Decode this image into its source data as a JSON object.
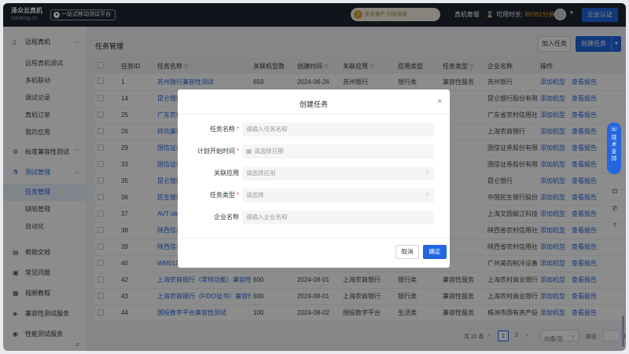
{
  "topbar": {
    "logo_line1": "泽众云真机",
    "logo_line2_prefix": "",
    "logo_line2": "ztesting.cn",
    "badge": "一站式移动测试平台",
    "notice": "实名客户 问答须奖",
    "real_device_link": "真机套餐",
    "timer_label": "可用时长:",
    "timer_value": "89361分钟",
    "cert_button": "企业认证"
  },
  "sidebar": {
    "groups": [
      {
        "label": "远程真机",
        "icon": "phone-icon",
        "items": [
          "远程真机调试",
          "多机联动",
          "调试记录",
          "真机订单",
          "我的应用"
        ]
      },
      {
        "label": "标准兼容性测试",
        "icon": "gear-icon"
      },
      {
        "label": "测试管理",
        "icon": "flask-icon",
        "items": [
          "任务管理",
          "缺陷管理",
          "自动化"
        ]
      },
      {
        "label": "帮助文档",
        "icon": "doc-icon"
      },
      {
        "label": "常见问题",
        "icon": "question-icon"
      },
      {
        "label": "视频教程",
        "icon": "video-icon"
      },
      {
        "label": "兼容性测试服务",
        "icon": "service-icon"
      },
      {
        "label": "性能测试服务",
        "icon": "perf-icon"
      }
    ]
  },
  "main": {
    "title": "任务管理",
    "join_button": "加入任务",
    "create_button": "创建任务",
    "columns": [
      "任务ID",
      "任务名称",
      "关联机型数",
      "创建时间",
      "关联应用",
      "应用类型",
      "任务类型",
      "企业名称",
      "操作"
    ],
    "rows": [
      [
        "1",
        "苏州银行兼容性测试",
        "659",
        "2024-06-26",
        "苏州银行",
        "银行类",
        "兼容性服务",
        "苏州银行"
      ],
      [
        "14",
        "昆仑银行",
        "",
        "",
        "",
        "",
        "",
        "昆仑银行股份有限"
      ],
      [
        "25",
        "广东农信",
        "",
        "",
        "",
        "",
        "",
        "广东省农村信用社"
      ],
      [
        "26",
        "绊功兼容",
        "",
        "",
        "",
        "",
        "",
        "上海农商银行"
      ],
      [
        "29",
        "国信证券",
        "",
        "",
        "",
        "",
        "",
        "国信证券股份有限"
      ],
      [
        "33",
        "国信证券",
        "",
        "",
        "",
        "",
        "",
        "国信证券股份有限"
      ],
      [
        "35",
        "昆仑银行",
        "",
        "",
        "",
        "",
        "",
        "昆仑银行"
      ],
      [
        "36",
        "民生银行",
        "",
        "",
        "",
        "",
        "",
        "中国民生银行股份"
      ],
      [
        "37",
        "AVT idea",
        "",
        "",
        "",
        "",
        "",
        "上海文圆娱江科技"
      ],
      [
        "38",
        "陕西信合",
        "",
        "",
        "",
        "",
        "",
        "陕西省农村信用社"
      ],
      [
        "39",
        "陕西信合",
        "",
        "",
        "",
        "",
        "",
        "陕西省农村信用社"
      ],
      [
        "40",
        "WM01兼容性测试",
        "",
        "",
        "",
        "",
        "",
        "广州美的制冷设备"
      ],
      [
        "42",
        "上海农商银行（常规功能）兼容性测试",
        "600",
        "2024-08-01",
        "上海农商银行",
        "银行类",
        "兼容性服务",
        "上海农村商业银行"
      ],
      [
        "43",
        "上海农商银行（FIDO证书）兼容性测试",
        "600",
        "2024-08-01",
        "上海农商银行",
        "银行类",
        "兼容性服务",
        "上海农村商业银行"
      ],
      [
        "44",
        "国投数字平台兼容性测试",
        "100",
        "2024-08-02",
        "国投数字平台",
        "生活类",
        "兼容性服务",
        "株洲市国有资产投"
      ]
    ],
    "row_actions": [
      "添加机型",
      "查看报告"
    ],
    "pager": {
      "total": "共 21 条",
      "pages": [
        "1",
        "2"
      ],
      "current": "1",
      "page_size": "20条/页",
      "goto_label": "前往",
      "goto_suffix": "页"
    }
  },
  "modal": {
    "title": "创建任务",
    "fields": [
      {
        "label": "任务名称",
        "required": true,
        "placeholder": "请输入任务名称",
        "type": "text"
      },
      {
        "label": "计划开始时间",
        "required": true,
        "placeholder": "请选择日期",
        "type": "date"
      },
      {
        "label": "关联应用",
        "required": false,
        "placeholder": "请选择应用",
        "type": "select"
      },
      {
        "label": "任务类型",
        "required": true,
        "placeholder": "请选择",
        "type": "select"
      },
      {
        "label": "企业名称",
        "required": false,
        "placeholder": "请输入企业名称",
        "type": "text"
      }
    ],
    "cancel": "取消",
    "confirm": "确定"
  },
  "float_tools": {
    "support_label": "技术支持"
  },
  "colors": {
    "primary": "#2266e0",
    "topbar": "#1f2531",
    "timer": "#f5a623",
    "required": "#e64a4a"
  }
}
